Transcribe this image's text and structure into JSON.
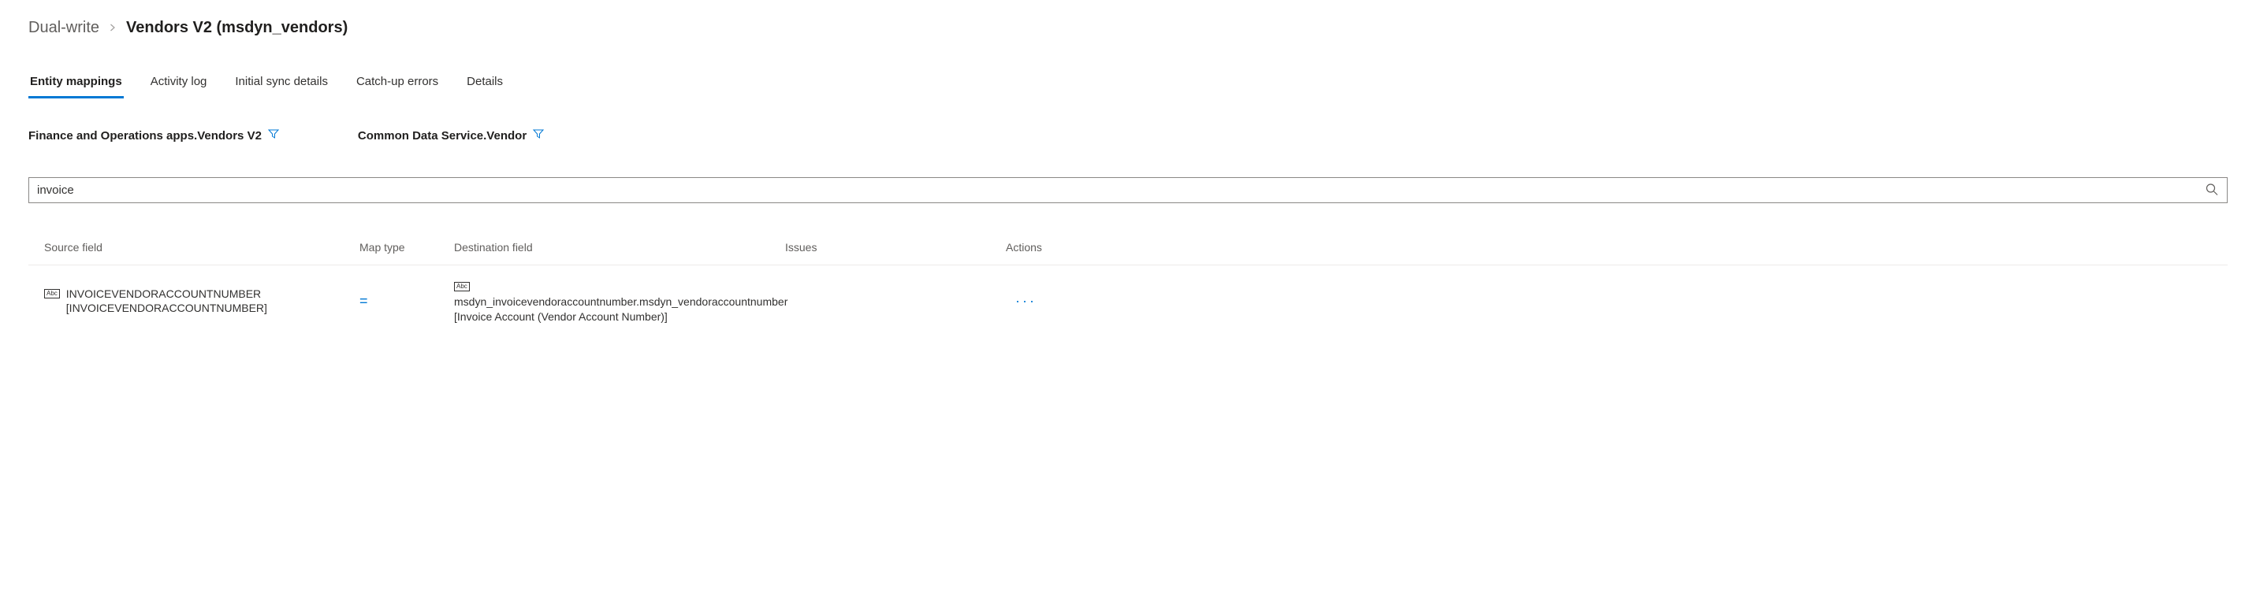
{
  "breadcrumb": {
    "parent": "Dual-write",
    "current": "Vendors V2 (msdyn_vendors)"
  },
  "tabs": [
    {
      "label": "Entity mappings",
      "active": true
    },
    {
      "label": "Activity log",
      "active": false
    },
    {
      "label": "Initial sync details",
      "active": false
    },
    {
      "label": "Catch-up errors",
      "active": false
    },
    {
      "label": "Details",
      "active": false
    }
  ],
  "entitySources": {
    "source": "Finance and Operations apps.Vendors V2",
    "destination": "Common Data Service.Vendor"
  },
  "search": {
    "value": "invoice"
  },
  "tableHeaders": {
    "sourceField": "Source field",
    "mapType": "Map type",
    "destinationField": "Destination field",
    "issues": "Issues",
    "actions": "Actions"
  },
  "rows": [
    {
      "sourceField": "INVOICEVENDORACCOUNTNUMBER [INVOICEVENDORACCOUNTNUMBER]",
      "mapType": "=",
      "destinationField": "msdyn_invoicevendoraccountnumber.msdyn_vendoraccountnumber [Invoice Account (Vendor Account Number)]",
      "issues": "",
      "actions": "···"
    }
  ],
  "icons": {
    "abc": "Abc"
  }
}
